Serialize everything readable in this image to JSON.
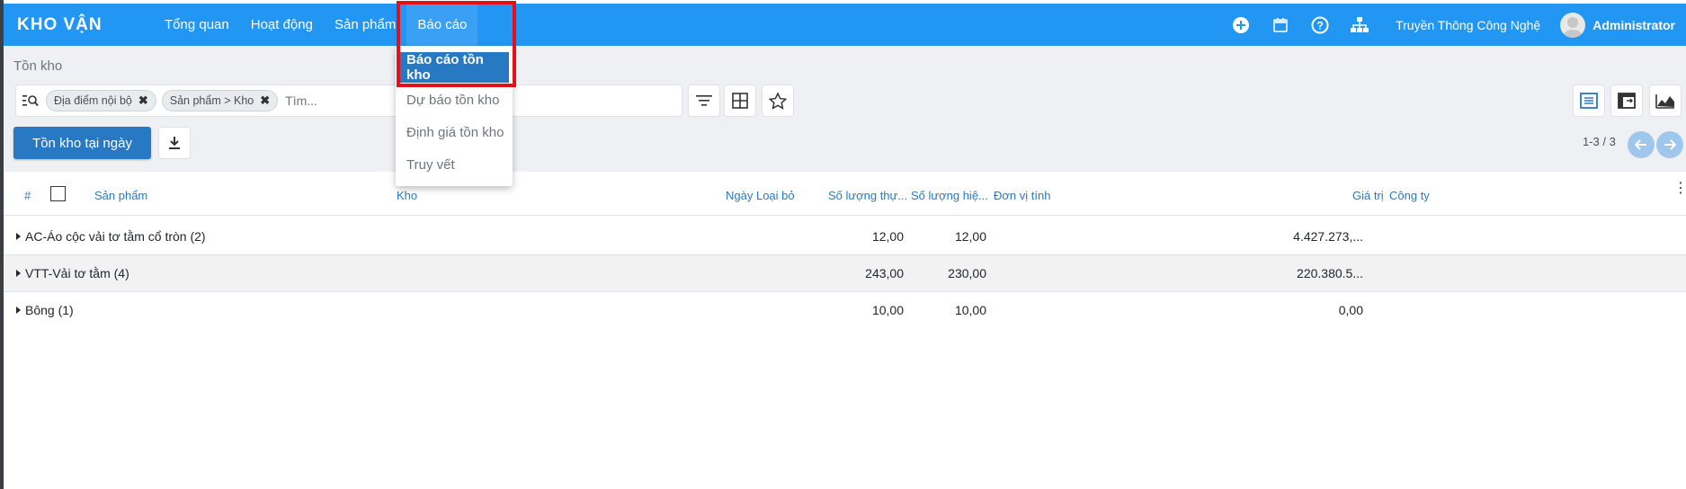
{
  "app": {
    "brand": "KHO VẬN",
    "menu": [
      {
        "label": "Tổng quan"
      },
      {
        "label": "Hoạt động"
      },
      {
        "label": "Sản phẩm"
      },
      {
        "label": "Báo cáo"
      }
    ],
    "company": "Truyền Thông Công Nghệ",
    "user": "Administrator",
    "colors": {
      "topbar": "#2196f3",
      "primary": "#2879c4",
      "highlight": "#e3101c"
    }
  },
  "dropdown": {
    "items": [
      {
        "label": "Báo cáo tồn kho"
      },
      {
        "label": "Dự báo tồn kho"
      },
      {
        "label": "Định giá tồn kho"
      },
      {
        "label": "Truy vết"
      }
    ]
  },
  "control": {
    "breadcrumb": "Tồn kho",
    "facets": [
      {
        "label": "Địa điểm nội bộ"
      },
      {
        "label": "Sản phẩm > Kho"
      }
    ],
    "search_placeholder": "Tìm...",
    "primary_button": "Tồn kho tại ngày",
    "pager": "1-3 / 3"
  },
  "table": {
    "headers": {
      "index": "#",
      "product": "Sản phẩm",
      "warehouse": "Kho",
      "removal_date": "Ngày Loại bỏ",
      "qty_actual": "Số lượng thự...",
      "qty_available": "Số lượng hiệ...",
      "uom": "Đơn vị tính",
      "value": "Giá trị",
      "company": "Công ty"
    },
    "rows": [
      {
        "group": "AC-Áo cộc vải tơ tằm cổ tròn (2)",
        "qty_actual": "12,00",
        "qty_available": "12,00",
        "value": "4.427.273,..."
      },
      {
        "group": "VTT-Vải tơ tằm (4)",
        "qty_actual": "243,00",
        "qty_available": "230,00",
        "value": "220.380.5..."
      },
      {
        "group": "Bông (1)",
        "qty_actual": "10,00",
        "qty_available": "10,00",
        "value": "0,00"
      }
    ]
  }
}
